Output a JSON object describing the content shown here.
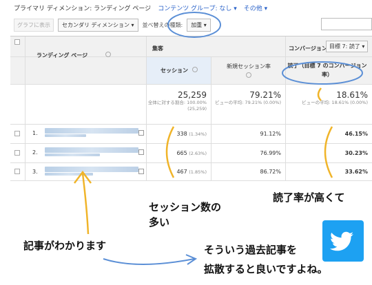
{
  "topbar": {
    "primary_dimension": "プライマリ ディメンション:  ランディング ページ",
    "content_group": "コンテンツ グループ: なし ▾",
    "other": "その他 ▾"
  },
  "controls": {
    "graph_button": "グラフに表示",
    "secondary_dimension": "セカンダリ ディメンション ▾",
    "sort_label": "並べ替えの種類:",
    "sort_value": "加重 ▾"
  },
  "table": {
    "group_header_traffic": "集客",
    "group_header_conversion": "コンバージョン",
    "goal_select": "目標 7: 読了 ▾",
    "col_landing_page": "ランディング ページ",
    "col_sessions": "セッション",
    "col_new_sessions": "新規セッション率",
    "col_goal_rate": "読了（目標 7 のコンバージョン率）",
    "totals": {
      "sessions": "25,259",
      "sessions_pct": "全体に対する割合: 100.00% (25,259)",
      "new_sessions": "79.21%",
      "new_sessions_avg": "ビューの平均: 79.21% (0.00%)",
      "goal_rate": "18.61%",
      "goal_rate_avg": "ビューの平均: 18.61% (0.00%)"
    },
    "rows": [
      {
        "index": "1.",
        "sessions": "338",
        "sessions_pct": "(1.34%)",
        "new_sessions": "91.12%",
        "goal_rate": "46.15%"
      },
      {
        "index": "2.",
        "sessions": "665",
        "sessions_pct": "(2.63%)",
        "new_sessions": "76.99%",
        "goal_rate": "30.23%"
      },
      {
        "index": "3.",
        "sessions": "467",
        "sessions_pct": "(1.85%)",
        "new_sessions": "86.72%",
        "goal_rate": "33.62%"
      }
    ]
  },
  "annotations": {
    "high_read_rate": "読了率が高くて",
    "many_sessions_line1": "セッション数の",
    "many_sessions_line2": "多い",
    "know_articles": "記事がわかります",
    "share_line1": "そういう過去記事を",
    "share_line2": "拡散すると良いですよね。"
  },
  "colors": {
    "highlight_orange": "#f0b429",
    "highlight_blue": "#5b8fd6",
    "twitter_blue": "#1da1f2"
  },
  "icons": [
    "help-icon",
    "open-link-icon",
    "twitter-bird-icon",
    "checkbox-icon"
  ]
}
